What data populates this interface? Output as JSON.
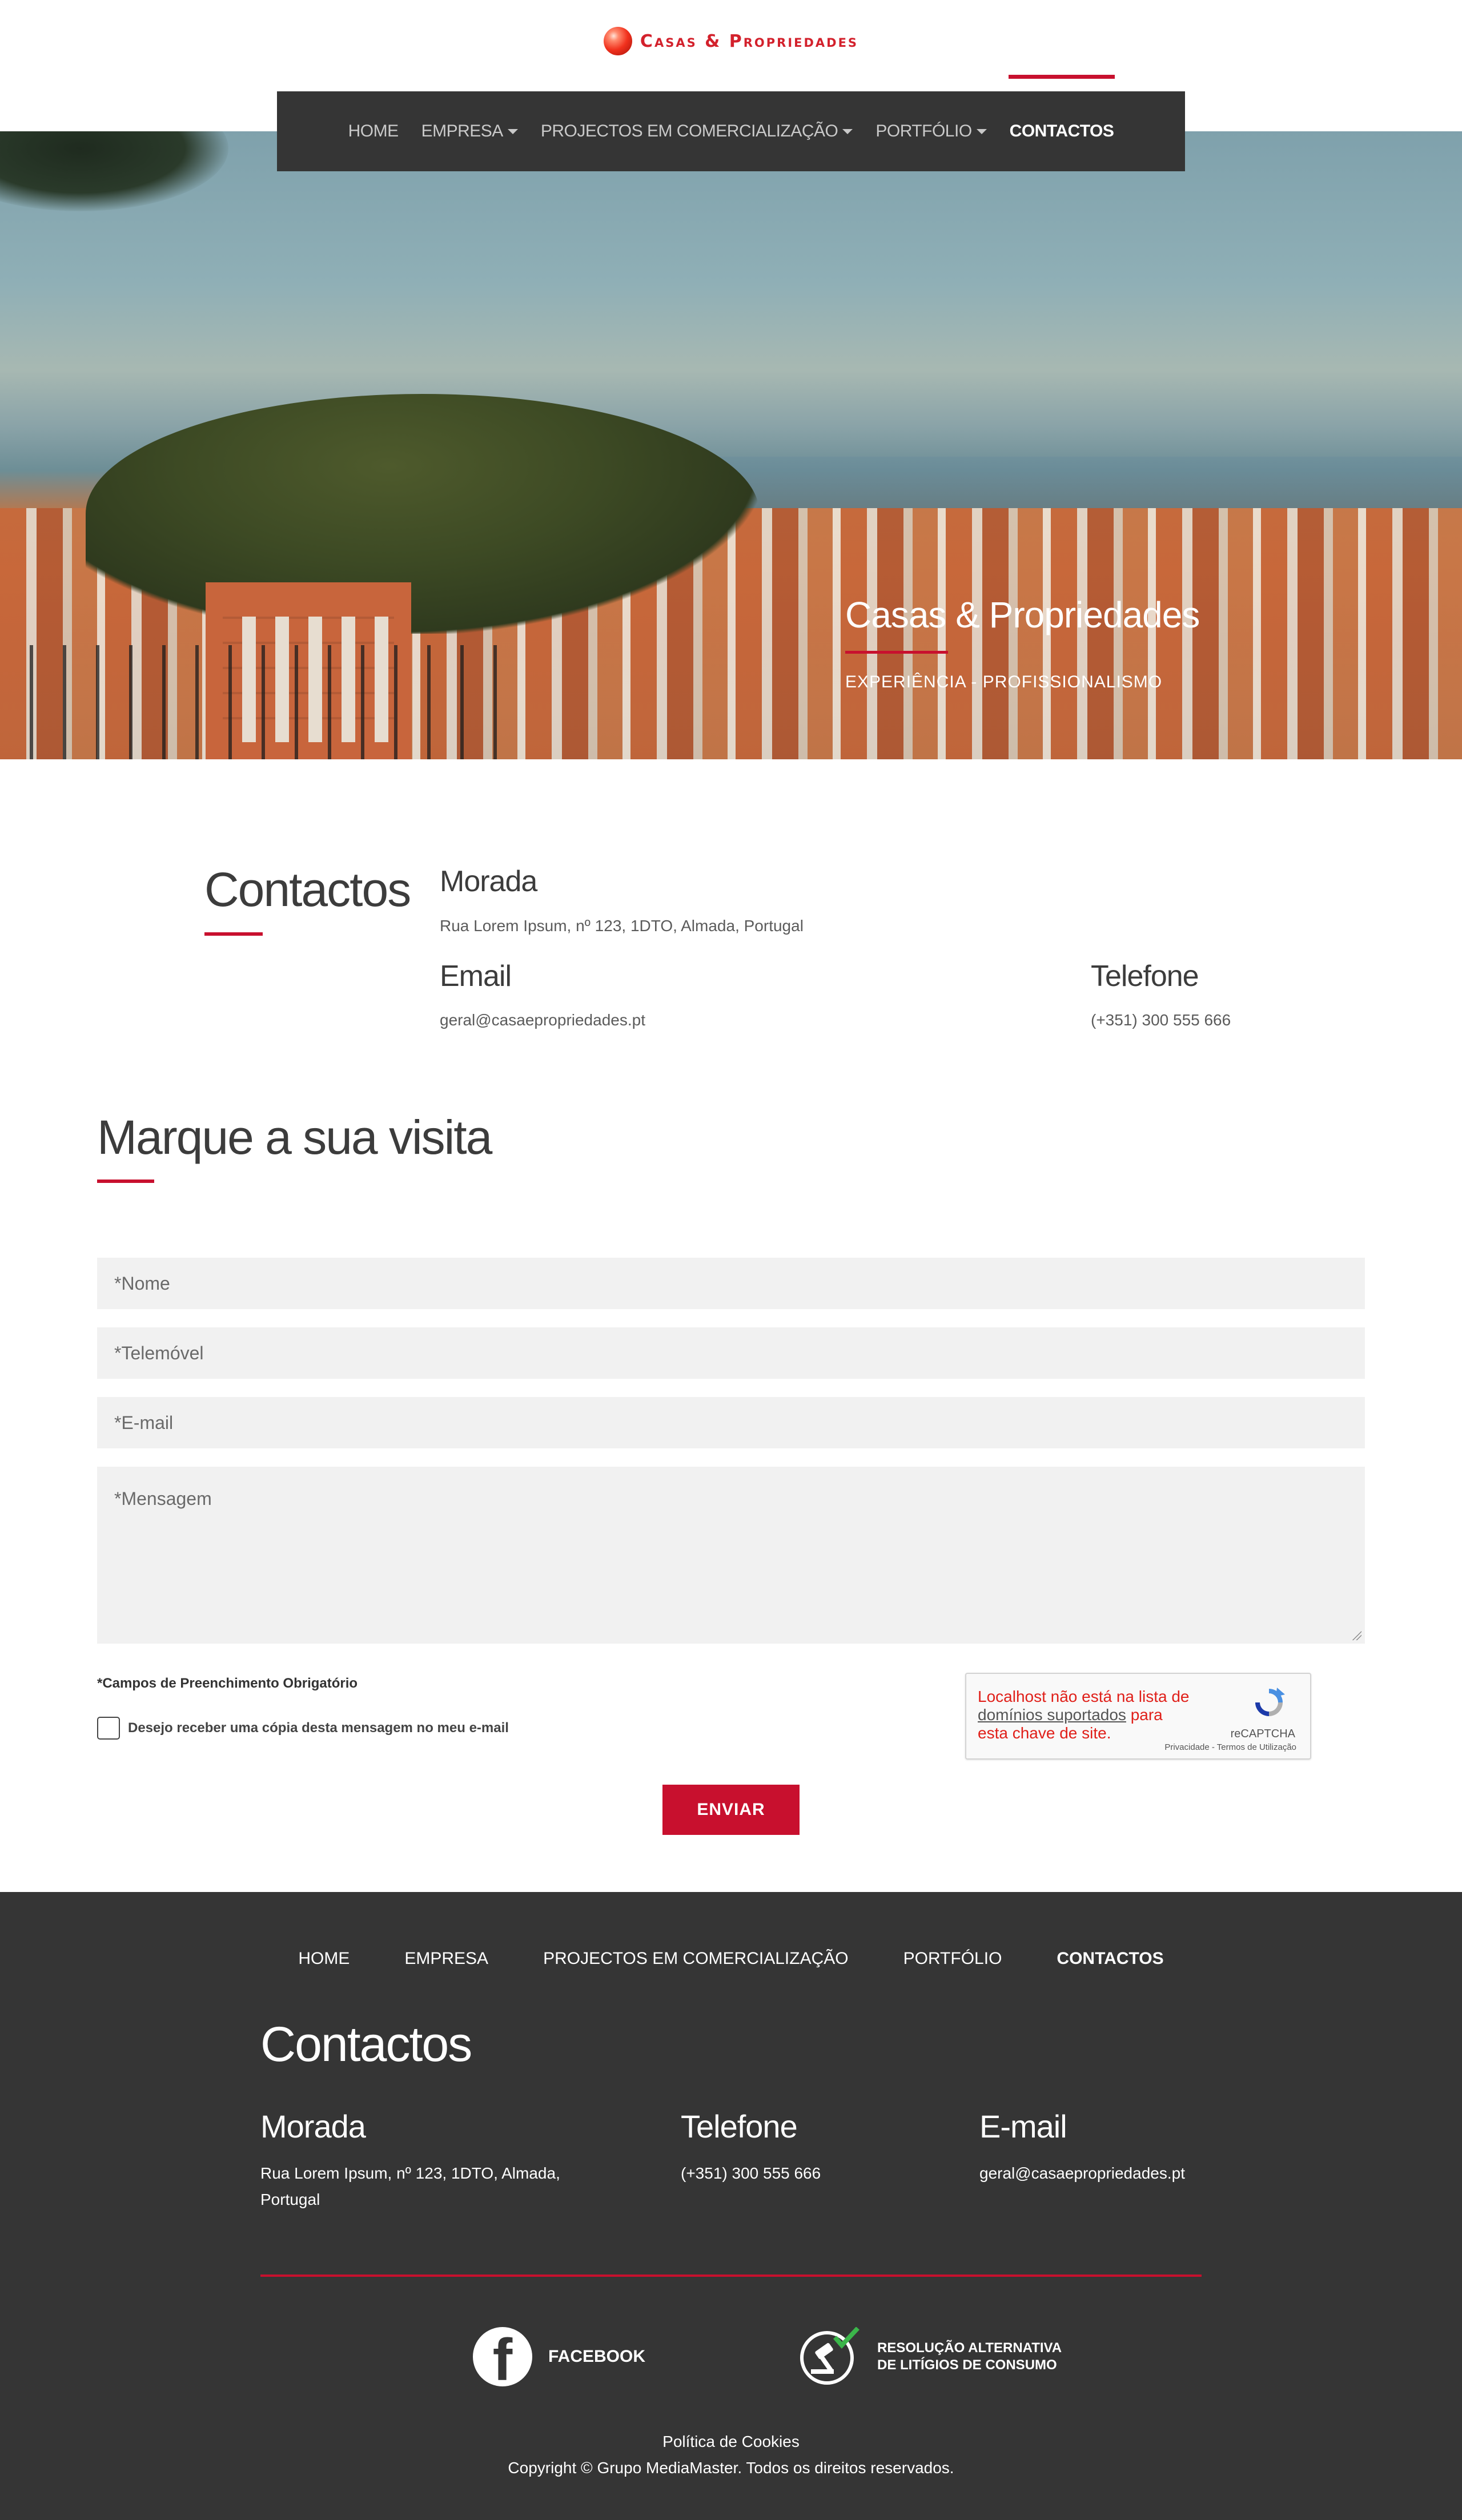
{
  "brand": {
    "name": "Casas & Propriedades"
  },
  "nav": {
    "items": [
      {
        "label": "HOME",
        "dropdown": false,
        "active": false
      },
      {
        "label": "EMPRESA",
        "dropdown": true,
        "active": false
      },
      {
        "label": "PROJECTOS EM COMERCIALIZAÇÃO",
        "dropdown": true,
        "active": false
      },
      {
        "label": "PORTFÓLIO",
        "dropdown": true,
        "active": false
      },
      {
        "label": "CONTACTOS",
        "dropdown": false,
        "active": true
      }
    ]
  },
  "hero": {
    "title": "Casas & Propriedades",
    "subtitle": "EXPERIÊNCIA - PROFISSIONALISMO"
  },
  "contacts": {
    "title": "Contactos",
    "address_label": "Morada",
    "address_value": "Rua Lorem Ipsum, nº 123, 1DTO, Almada, Portugal",
    "email_label": "Email",
    "email_value": "geral@casaepropriedades.pt",
    "phone_label": "Telefone",
    "phone_value": "(+351) 300 555 666"
  },
  "form": {
    "title": "Marque a sua visita",
    "name_placeholder": "*Nome",
    "mobile_placeholder": "*Telemóvel",
    "email_placeholder": "*E-mail",
    "message_placeholder": "*Mensagem",
    "required_note": "*Campos de Preenchimento Obrigatório",
    "copy_checkbox_label": "Desejo receber uma cópia desta mensagem no meu e-mail",
    "copy_checked": false,
    "submit_label": "ENVIAR"
  },
  "recaptcha": {
    "msg_part1": "Localhost não está na lista de ",
    "msg_link": "domínios suportados",
    "msg_part2": " para esta chave de site.",
    "brand": "reCAPTCHA",
    "terms": "Privacidade - Termos de Utilização"
  },
  "footer": {
    "nav": [
      {
        "label": "HOME",
        "active": false
      },
      {
        "label": "EMPRESA",
        "active": false
      },
      {
        "label": "PROJECTOS EM COMERCIALIZAÇÃO",
        "active": false
      },
      {
        "label": "PORTFÓLIO",
        "active": false
      },
      {
        "label": "CONTACTOS",
        "active": true
      }
    ],
    "title": "Contactos",
    "address_label": "Morada",
    "address_line1": "Rua Lorem Ipsum, nº 123, 1DTO, Almada,",
    "address_line2": "Portugal",
    "phone_label": "Telefone",
    "phone_value": "(+351) 300 555 666",
    "email_label": "E-mail",
    "email_value": "geral@casaepropriedades.pt",
    "facebook_label": "FACEBOOK",
    "ral_line1": "RESOLUÇÃO ALTERNATIVA",
    "ral_line2": "DE LITÍGIOS DE CONSUMO",
    "cookies_label": "Política de Cookies",
    "copyright": "Copyright © Grupo MediaMaster. Todos os direitos reservados."
  },
  "colors": {
    "accent": "#c8102e",
    "dark": "#353535",
    "field_bg": "#f1f1f1"
  },
  "icons": [
    "logo-ball-icon",
    "caret-down-icon",
    "recaptcha-icon",
    "facebook-icon",
    "ral-gavel-icon",
    "resize-grip-icon"
  ]
}
